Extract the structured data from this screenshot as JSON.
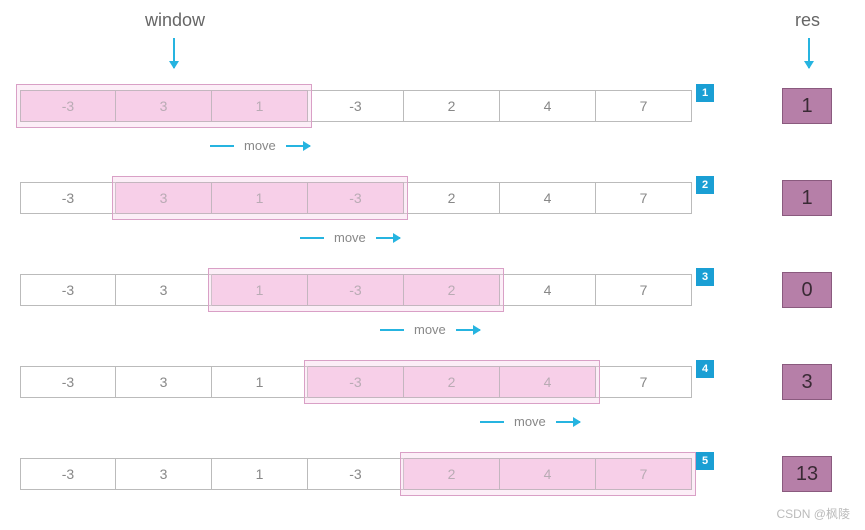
{
  "labels": {
    "window": "window",
    "res": "res",
    "move": "move"
  },
  "chart_data": {
    "type": "table",
    "array": [
      -3,
      3,
      1,
      -3,
      2,
      4,
      7
    ],
    "window_size": 3,
    "steps": [
      {
        "step": 1,
        "window_start": 0,
        "window_values": [
          -3,
          3,
          1
        ],
        "res": 1
      },
      {
        "step": 2,
        "window_start": 1,
        "window_values": [
          3,
          1,
          -3
        ],
        "res": 1
      },
      {
        "step": 3,
        "window_start": 2,
        "window_values": [
          1,
          -3,
          2
        ],
        "res": 0
      },
      {
        "step": 4,
        "window_start": 3,
        "window_values": [
          -3,
          2,
          4
        ],
        "res": 3
      },
      {
        "step": 5,
        "window_start": 4,
        "window_values": [
          2,
          4,
          7
        ],
        "res": 13
      }
    ]
  },
  "watermark": "CSDN @枫陵"
}
